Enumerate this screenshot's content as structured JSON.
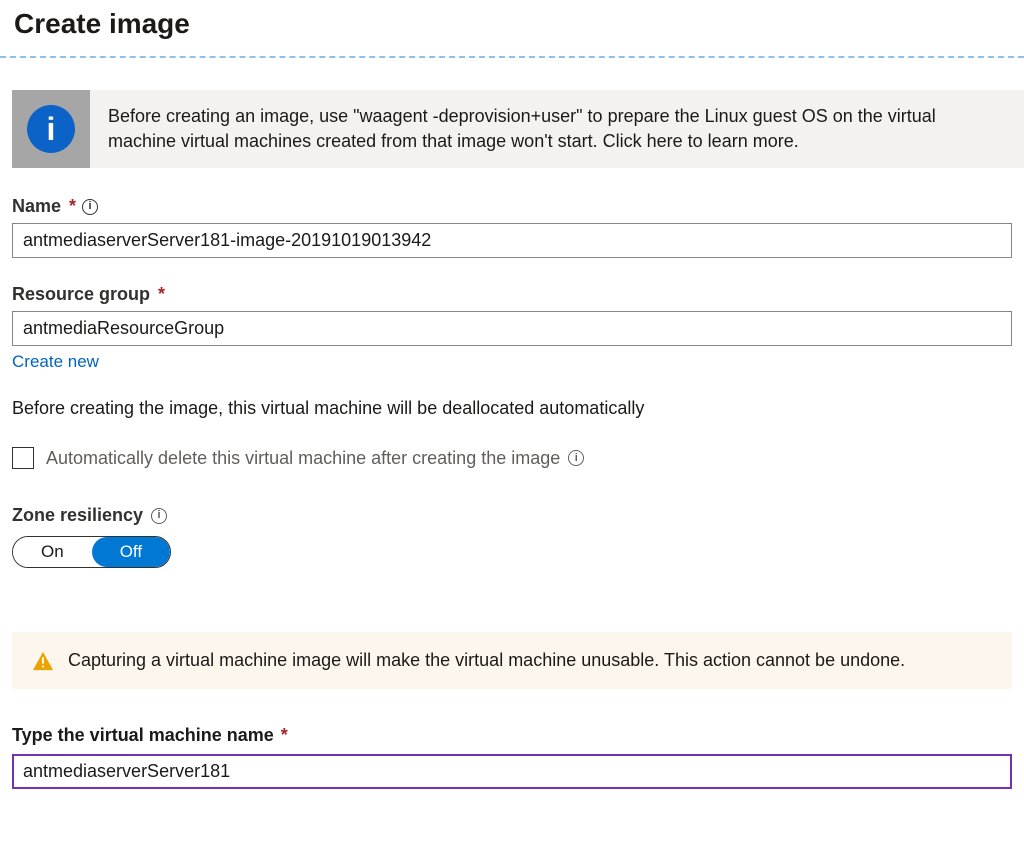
{
  "title": "Create image",
  "infoBanner": {
    "text": "Before creating an image, use \"waagent -deprovision+user\" to prepare the Linux guest OS on the virtual machine virtual machines created from that image won't start. Click here to learn more.",
    "icon": "info-icon"
  },
  "fields": {
    "name": {
      "label": "Name",
      "required": true,
      "value": "antmediaserverServer181-image-20191019013942"
    },
    "resourceGroup": {
      "label": "Resource group",
      "required": true,
      "value": "antmediaResourceGroup",
      "createNewLink": "Create new"
    }
  },
  "deallocateNote": "Before creating the image, this virtual machine will be deallocated automatically",
  "autoDelete": {
    "label": "Automatically delete this virtual machine after creating the image",
    "checked": false
  },
  "zoneResiliency": {
    "label": "Zone resiliency",
    "options": {
      "on": "On",
      "off": "Off"
    },
    "selected": "off"
  },
  "warning": {
    "text": "Capturing a virtual machine image will make the virtual machine unusable. This action cannot be undone."
  },
  "confirm": {
    "label": "Type the virtual machine name",
    "required": true,
    "value": "antmediaserverServer181"
  }
}
